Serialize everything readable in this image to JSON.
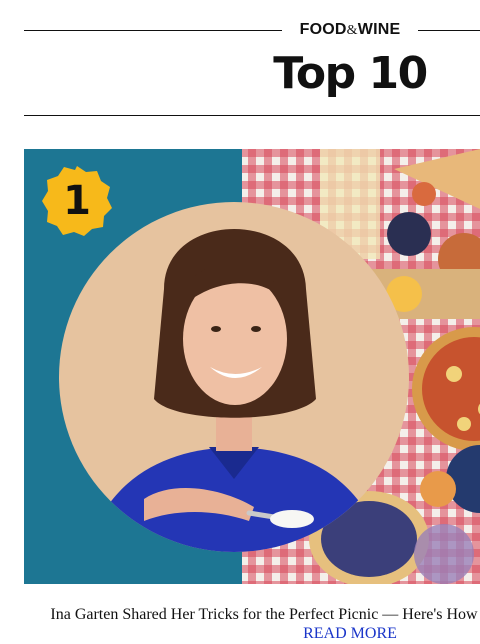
{
  "header": {
    "brand_left": "FOOD",
    "brand_amp": "&",
    "brand_right": "WINE",
    "section_title": "Top 10"
  },
  "hero": {
    "rank_badge": "1",
    "badge_color": "#f7b91a",
    "background_color": "#1d7693",
    "circle_color": "#e6c39f",
    "shirt_color": "#2436b5"
  },
  "article": {
    "headline": "Ina Garten Shared Her Tricks for the Perfect Picnic — Here's How",
    "read_more": "READ MORE",
    "link_color": "#1a35c9"
  }
}
